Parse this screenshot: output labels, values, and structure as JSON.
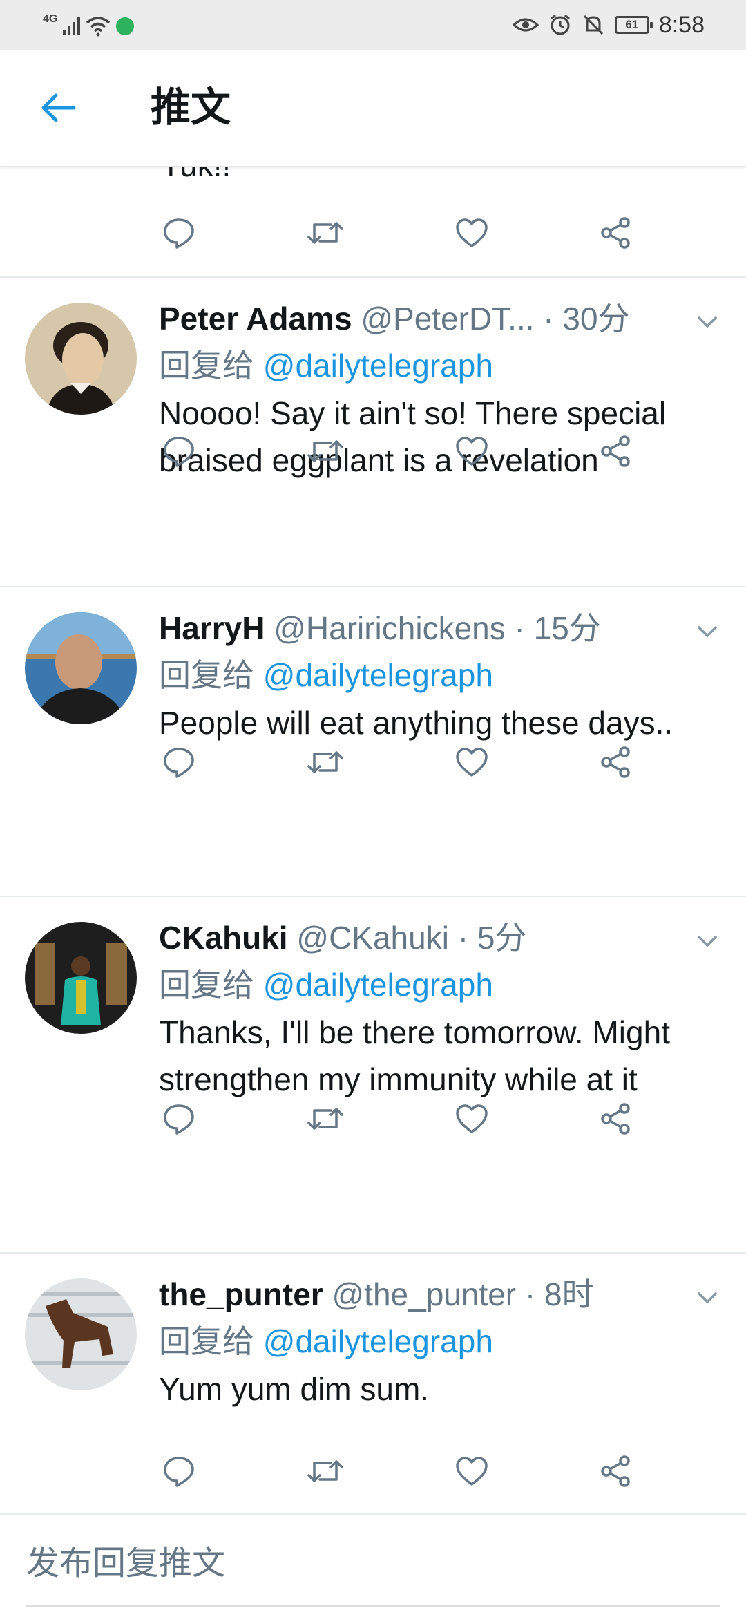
{
  "status_bar": {
    "network": "4G",
    "battery": "61",
    "time": "8:58"
  },
  "header": {
    "title": "推文"
  },
  "partial_tweet": {
    "text_fragment": "Yuk!!"
  },
  "tweets": [
    {
      "name": "Peter Adams",
      "handle": "@PeterDT...",
      "time": "· 30分",
      "reply_prefix": "回复给",
      "reply_to": "@dailytelegraph",
      "text": "Noooo! Say it ain't so! There special braised eggplant is a revelation",
      "avatar_colors": [
        "#6b5a4a",
        "#e0d2b8"
      ]
    },
    {
      "name": "HarryH",
      "handle": "@Haririchickens",
      "time": "· 15分",
      "reply_prefix": "回复给",
      "reply_to": "@dailytelegraph",
      "text": "People will eat anything these days..",
      "avatar_colors": [
        "#2f6fa8",
        "#c89a7c"
      ]
    },
    {
      "name": "CKahuki",
      "handle": "@CKahuki",
      "time": "· 5分",
      "reply_prefix": "回复给",
      "reply_to": "@dailytelegraph",
      "text": "Thanks, I'll be there tomorrow. Might strengthen my immunity while at it",
      "avatar_colors": [
        "#2a2a2a",
        "#1fb3a3"
      ]
    },
    {
      "name": "the_punter",
      "handle": "@the_punter",
      "time": "· 8时",
      "reply_prefix": "回复给",
      "reply_to": "@dailytelegraph",
      "text": "Yum yum dim sum.",
      "avatar_colors": [
        "#d9dde0",
        "#5a3520"
      ]
    }
  ],
  "compose": {
    "placeholder": "发布回复推文"
  },
  "colors": {
    "accent": "#1b95e0",
    "secondary_text": "#657786",
    "icon": "#657786"
  }
}
